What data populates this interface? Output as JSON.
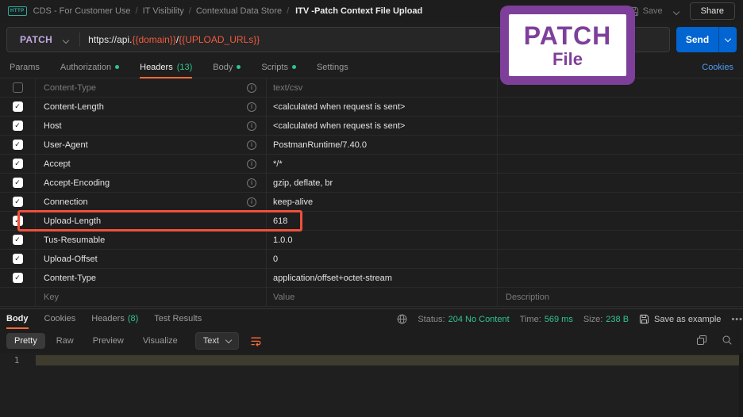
{
  "colors": {
    "accent_orange": "#ff6c37",
    "method_patch": "#c0a8e1",
    "variable_orange": "#f15a3d",
    "send_blue": "#0265d2",
    "link_blue": "#539bf5",
    "success_green": "#31c48d",
    "badge_purple": "#7e3f9b",
    "highlight_red": "#f0503a",
    "http_teal": "#2fa99e"
  },
  "topbar": {
    "http_badge": "HTTP",
    "breadcrumbs": [
      "CDS - For Customer Use",
      "IT Visibility",
      "Contextual Data Store"
    ],
    "request_title": "ITV -Patch Context File Upload",
    "save_label": "Save",
    "share_label": "Share"
  },
  "request": {
    "method": "PATCH",
    "url_parts": [
      {
        "text": "https://api.",
        "var": false
      },
      {
        "text": "{{domain}}",
        "var": true
      },
      {
        "text": "/",
        "var": false
      },
      {
        "text": "{{UPLOAD_URLs}}",
        "var": true
      }
    ],
    "send_label": "Send"
  },
  "request_tabs": {
    "items": [
      {
        "label": "Params"
      },
      {
        "label": "Authorization",
        "dot": true
      },
      {
        "label": "Headers",
        "count": "(13)",
        "active": true
      },
      {
        "label": "Body",
        "dot": true
      },
      {
        "label": "Scripts",
        "dot": true
      },
      {
        "label": "Settings"
      }
    ],
    "cookies_link": "Cookies"
  },
  "headers_table": {
    "rows": [
      {
        "key": "Content-Type",
        "value": "text/csv",
        "checked": false,
        "info": true,
        "muted": true
      },
      {
        "key": "Content-Length",
        "value": "<calculated when request is sent>",
        "checked": true,
        "info": true
      },
      {
        "key": "Host",
        "value": "<calculated when request is sent>",
        "checked": true,
        "info": true
      },
      {
        "key": "User-Agent",
        "value": "PostmanRuntime/7.40.0",
        "checked": true,
        "info": true
      },
      {
        "key": "Accept",
        "value": "*/*",
        "checked": true,
        "info": true
      },
      {
        "key": "Accept-Encoding",
        "value": "gzip, deflate, br",
        "checked": true,
        "info": true
      },
      {
        "key": "Connection",
        "value": "keep-alive",
        "checked": true,
        "info": true
      },
      {
        "key": "Upload-Length",
        "value": "618",
        "checked": true,
        "highlight": true
      },
      {
        "key": "Tus-Resumable",
        "value": "1.0.0",
        "checked": true
      },
      {
        "key": "Upload-Offset",
        "value": "0",
        "checked": true
      },
      {
        "key": "Content-Type",
        "value": "application/offset+octet-stream",
        "checked": true
      },
      {
        "key": "Key",
        "value": "Value",
        "description": "Description",
        "placeholder": true,
        "muted": true
      }
    ]
  },
  "annotation": {
    "line1": "PATCH",
    "line2": "File"
  },
  "response": {
    "tabs": [
      {
        "label": "Body",
        "active": true
      },
      {
        "label": "Cookies"
      },
      {
        "label": "Headers",
        "count": "(8)"
      },
      {
        "label": "Test Results"
      }
    ],
    "meta": [
      {
        "label": "Status:",
        "value": "204 No Content"
      },
      {
        "label": "Time:",
        "value": "569 ms"
      },
      {
        "label": "Size:",
        "value": "238 B"
      }
    ],
    "save_as_example": "Save as example",
    "view_tabs": [
      {
        "label": "Pretty",
        "active": true
      },
      {
        "label": "Raw"
      },
      {
        "label": "Preview"
      },
      {
        "label": "Visualize"
      }
    ],
    "format_select": "Text",
    "line_number": "1"
  }
}
